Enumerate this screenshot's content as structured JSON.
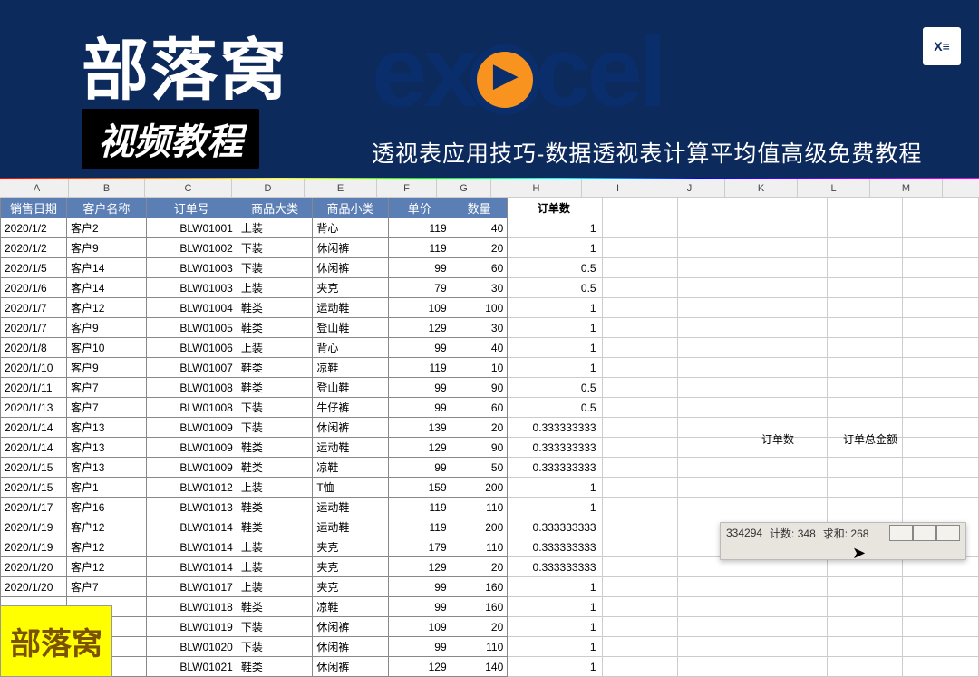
{
  "banner": {
    "logo_cn": "部落窝",
    "logo_sub": "视频教程",
    "excel_e1": "e",
    "excel_x": "x",
    "excel_c": "c",
    "excel_e2": "e",
    "excel_l": "l",
    "subtitle": "透视表应用技巧-数据透视表计算平均值高级免费教程",
    "excel_badge": "X≡"
  },
  "cols": [
    "A",
    "B",
    "C",
    "D",
    "E",
    "F",
    "G",
    "H",
    "I",
    "J",
    "K",
    "L",
    "M"
  ],
  "headers": {
    "A": "销售日期",
    "B": "客户名称",
    "C": "订单号",
    "D": "商品大类",
    "E": "商品小类",
    "F": "单价",
    "G": "数量",
    "H": "订单数"
  },
  "pivot": {
    "label1": "订单数",
    "label2": "订单总金额"
  },
  "status": {
    "avg_partial": "334294",
    "count": "计数: 348",
    "sum": "求和: 268"
  },
  "watermark": "部落窝",
  "rows": [
    {
      "date": "2020/1/2",
      "cust": "客户2",
      "ord": "BLW01001",
      "cat": "上装",
      "sub": "背心",
      "price": "119",
      "qty": "40",
      "h": "1"
    },
    {
      "date": "2020/1/2",
      "cust": "客户9",
      "ord": "BLW01002",
      "cat": "下装",
      "sub": "休闲裤",
      "price": "119",
      "qty": "20",
      "h": "1"
    },
    {
      "date": "2020/1/5",
      "cust": "客户14",
      "ord": "BLW01003",
      "cat": "下装",
      "sub": "休闲裤",
      "price": "99",
      "qty": "60",
      "h": "0.5"
    },
    {
      "date": "2020/1/6",
      "cust": "客户14",
      "ord": "BLW01003",
      "cat": "上装",
      "sub": "夹克",
      "price": "79",
      "qty": "30",
      "h": "0.5"
    },
    {
      "date": "2020/1/7",
      "cust": "客户12",
      "ord": "BLW01004",
      "cat": "鞋类",
      "sub": "运动鞋",
      "price": "109",
      "qty": "100",
      "h": "1"
    },
    {
      "date": "2020/1/7",
      "cust": "客户9",
      "ord": "BLW01005",
      "cat": "鞋类",
      "sub": "登山鞋",
      "price": "129",
      "qty": "30",
      "h": "1"
    },
    {
      "date": "2020/1/8",
      "cust": "客户10",
      "ord": "BLW01006",
      "cat": "上装",
      "sub": "背心",
      "price": "99",
      "qty": "40",
      "h": "1"
    },
    {
      "date": "2020/1/10",
      "cust": "客户9",
      "ord": "BLW01007",
      "cat": "鞋类",
      "sub": "凉鞋",
      "price": "119",
      "qty": "10",
      "h": "1"
    },
    {
      "date": "2020/1/11",
      "cust": "客户7",
      "ord": "BLW01008",
      "cat": "鞋类",
      "sub": "登山鞋",
      "price": "99",
      "qty": "90",
      "h": "0.5"
    },
    {
      "date": "2020/1/13",
      "cust": "客户7",
      "ord": "BLW01008",
      "cat": "下装",
      "sub": "牛仔裤",
      "price": "99",
      "qty": "60",
      "h": "0.5"
    },
    {
      "date": "2020/1/14",
      "cust": "客户13",
      "ord": "BLW01009",
      "cat": "下装",
      "sub": "休闲裤",
      "price": "139",
      "qty": "20",
      "h": "0.333333333"
    },
    {
      "date": "2020/1/14",
      "cust": "客户13",
      "ord": "BLW01009",
      "cat": "鞋类",
      "sub": "运动鞋",
      "price": "129",
      "qty": "90",
      "h": "0.333333333"
    },
    {
      "date": "2020/1/15",
      "cust": "客户13",
      "ord": "BLW01009",
      "cat": "鞋类",
      "sub": "凉鞋",
      "price": "99",
      "qty": "50",
      "h": "0.333333333"
    },
    {
      "date": "2020/1/15",
      "cust": "客户1",
      "ord": "BLW01012",
      "cat": "上装",
      "sub": "T恤",
      "price": "159",
      "qty": "200",
      "h": "1"
    },
    {
      "date": "2020/1/17",
      "cust": "客户16",
      "ord": "BLW01013",
      "cat": "鞋类",
      "sub": "运动鞋",
      "price": "119",
      "qty": "110",
      "h": "1"
    },
    {
      "date": "2020/1/19",
      "cust": "客户12",
      "ord": "BLW01014",
      "cat": "鞋类",
      "sub": "运动鞋",
      "price": "119",
      "qty": "200",
      "h": "0.333333333"
    },
    {
      "date": "2020/1/19",
      "cust": "客户12",
      "ord": "BLW01014",
      "cat": "上装",
      "sub": "夹克",
      "price": "179",
      "qty": "110",
      "h": "0.333333333"
    },
    {
      "date": "2020/1/20",
      "cust": "客户12",
      "ord": "BLW01014",
      "cat": "上装",
      "sub": "夹克",
      "price": "129",
      "qty": "20",
      "h": "0.333333333"
    },
    {
      "date": "2020/1/20",
      "cust": "客户7",
      "ord": "BLW01017",
      "cat": "上装",
      "sub": "夹克",
      "price": "99",
      "qty": "160",
      "h": "1"
    },
    {
      "date": "",
      "cust": "",
      "ord": "BLW01018",
      "cat": "鞋类",
      "sub": "凉鞋",
      "price": "99",
      "qty": "160",
      "h": "1"
    },
    {
      "date": "",
      "cust": "",
      "ord": "BLW01019",
      "cat": "下装",
      "sub": "休闲裤",
      "price": "109",
      "qty": "20",
      "h": "1"
    },
    {
      "date": "",
      "cust": "",
      "ord": "BLW01020",
      "cat": "下装",
      "sub": "休闲裤",
      "price": "99",
      "qty": "110",
      "h": "1"
    },
    {
      "date": "",
      "cust": "",
      "ord": "BLW01021",
      "cat": "鞋类",
      "sub": "休闲裤",
      "price": "129",
      "qty": "140",
      "h": "1"
    }
  ]
}
